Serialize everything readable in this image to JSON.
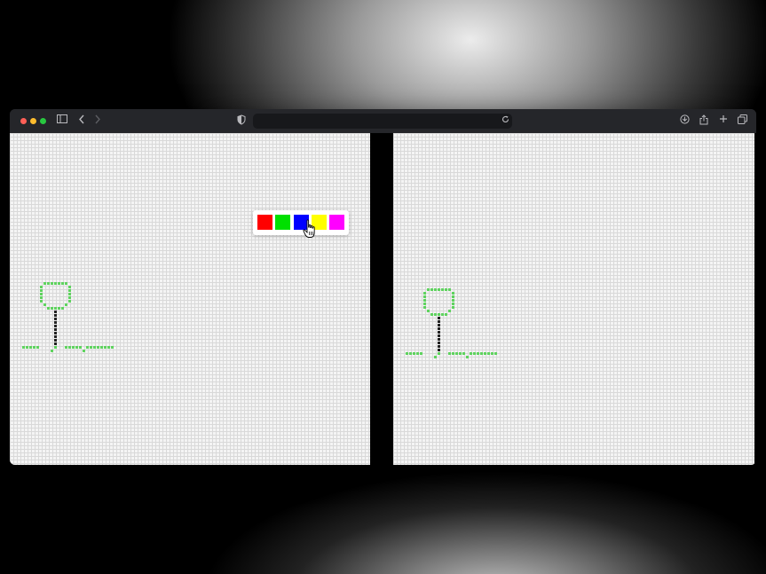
{
  "window": {
    "title": "",
    "address": ""
  },
  "toolbar_icons": [
    "sidebar-icon",
    "back-icon",
    "forward-icon",
    "privacy-shield-icon",
    "reload-icon",
    "download-icon",
    "share-icon",
    "new-tab-icon",
    "tab-overview-icon"
  ],
  "palette": {
    "colors": [
      {
        "name": "red",
        "hex": "#ff0000"
      },
      {
        "name": "green",
        "hex": "#00e000"
      },
      {
        "name": "blue",
        "hex": "#0000ff"
      },
      {
        "name": "yellow",
        "hex": "#ffff00"
      },
      {
        "name": "magenta",
        "hex": "#ff00ff"
      }
    ],
    "hovered": "blue"
  },
  "drawing": {
    "tree_color": "#5fd35f",
    "trunk_color": "#222222",
    "grid_color": "#d9d9d9"
  }
}
